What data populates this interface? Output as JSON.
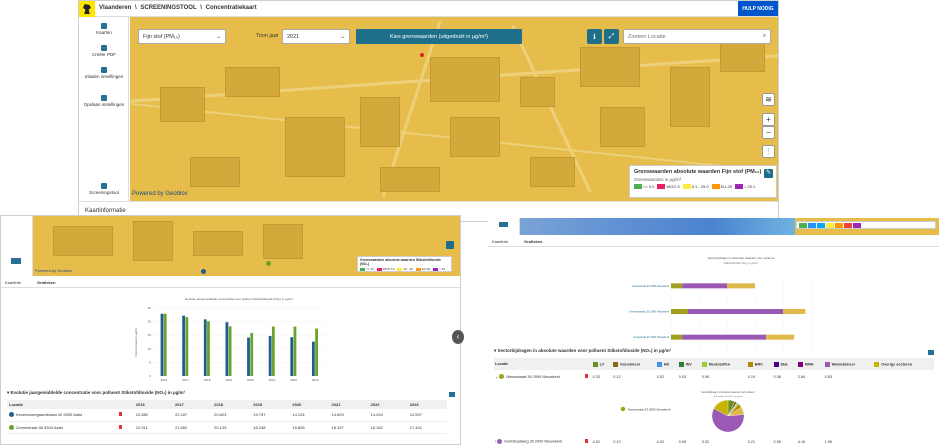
{
  "top": {
    "breadcrumb": [
      "Vlaanderen",
      "\\",
      "SCREENINGSTOOL",
      "\\",
      "Concentratiekaart"
    ],
    "help_label": "HULP NODIG",
    "sidebar": [
      {
        "label": "Kaarten",
        "icon": "layers-icon"
      },
      {
        "label": "Creëer PDF",
        "icon": "pdf-icon"
      },
      {
        "label": "Inladen instellingen",
        "icon": "upload-icon"
      },
      {
        "label": "Opslaan instellingen",
        "icon": "save-icon"
      },
      {
        "label": "Screeningstool",
        "icon": "link-icon"
      }
    ],
    "pollutant_select": "Fijn stof (PM₁₀)",
    "toon_jaar_label": "Toon jaar",
    "year_select": "2021",
    "toggle_button": "Kies grenswaarden (uitgedrukt in µg/m³)",
    "search_placeholder": "Zoeken Locatie",
    "legend_title": "Grenswaarden absolute waarden Fijn stof (PM₁₀)",
    "legend_subtitle": "Grenswaarden in µg/m³",
    "legend_items": [
      {
        "label": "<= 5.0",
        "color": "#4caf50"
      },
      {
        "label": "WGO 5",
        "color": "#e91e63"
      },
      {
        "label": "5.1 - 25.0",
        "color": "#ffeb3b"
      },
      {
        "label": "EU-25",
        "color": "#ff9800"
      },
      {
        "label": "> 25.1",
        "color": "#9c27b0"
      }
    ],
    "powered_by": "Powered by Geoblox",
    "tab": "Kaartinformatie"
  },
  "bottom_left": {
    "tabs": [
      "Kaartinfo",
      "Grafieken"
    ],
    "legend_title": "Grenswaarden absolute waarden Stikstofdioxide (NO₂)",
    "legend_items": [
      {
        "label": "<= 10",
        "color": "#4caf50"
      },
      {
        "label": "WGO 10",
        "color": "#e91e63"
      },
      {
        "label": "10 - 40",
        "color": "#ffeb3b"
      },
      {
        "label": "EU-40",
        "color": "#ff9800"
      },
      {
        "label": "> 40",
        "color": "#9c27b0"
      }
    ],
    "powered_by": "Powered by Geoblox",
    "table_title": "Evolutie jaargemiddelde concentratie voor polluent Stikstofdioxide (NO₂) in µg/m³",
    "table_headers": [
      "Locatie",
      "",
      "2016",
      "2017",
      "2018",
      "2019",
      "2020",
      "2021",
      "2022",
      "2023"
    ],
    "table_rows": [
      {
        "dot": "#1f5f8b",
        "name": "Kerseboomgaardstraat 42 9000 Aalst",
        "values": [
          "22.882",
          "22.187",
          "20.823",
          "19.797",
          "14.124",
          "14.693",
          "14.264",
          "12.597"
        ]
      },
      {
        "dot": "#6aa329",
        "name": "Zonnestraat 48 9300 Aalst",
        "values": [
          "22.911",
          "21.652",
          "20.139",
          "18.248",
          "15.806",
          "18.197",
          "18.182",
          "17.441"
        ]
      }
    ],
    "chart_data": {
      "type": "bar",
      "title": "Evolutie jaargemiddelde concentratie voor polluent Stikstofdioxide (NO₂) in µg/m³",
      "ylabel": "Concentratie in µg/m³",
      "categories": [
        "2016",
        "2017",
        "2018",
        "2019",
        "2020",
        "2021",
        "2022",
        "2023"
      ],
      "ylim": [
        0,
        25
      ],
      "yticks": [
        0,
        5,
        10,
        15,
        20,
        25
      ],
      "series": [
        {
          "name": "Kerseboomgaardstraat 42 9000 Aalst",
          "color": "#1f5f8b",
          "values": [
            22.882,
            22.187,
            20.823,
            19.797,
            14.124,
            14.693,
            14.264,
            12.597
          ]
        },
        {
          "name": "Zonnestraat 48 9300 Aalst",
          "color": "#6aa329",
          "values": [
            22.911,
            21.652,
            20.139,
            18.248,
            15.806,
            18.197,
            18.182,
            17.441
          ]
        }
      ]
    }
  },
  "bottom_right": {
    "tabs": [
      "Kaartinfo",
      "Grafieken"
    ],
    "chart_data": {
      "type": "bar",
      "stacked": true,
      "orientation": "horizontal",
      "title": "Sectorbijdragen in absolute waarden voor polluent",
      "subtitle": "Stikstofdioxide (NO₂) in µg/m³",
      "xlabel": "Bijdrage in µg/m³",
      "categories": [
        "Nieuwstraat 35 2990 Nieuwkerk",
        "Kerkstraatweg 35 2990 Nieuwkerk",
        "Hoogstraat 46 2990 Nieuwkerk"
      ],
      "xlim": [
        0,
        25
      ],
      "xticks": [
        0,
        5,
        10,
        15,
        20,
        25
      ],
      "series": [
        {
          "name": "Verkeer",
          "color": "#a0a01e",
          "values": [
            2,
            3,
            2
          ]
        },
        {
          "name": "Industrie",
          "color": "#9b59b6",
          "values": [
            8,
            17,
            15
          ]
        },
        {
          "name": "Overige",
          "color": "#e0b94b",
          "values": [
            5,
            4,
            5
          ]
        }
      ]
    },
    "table_title": "Sectorbijdragen in absolute waarden voor polluent Stikstofdioxide (NO₂) in µg/m³",
    "table_headers": [
      {
        "label": "Locatie",
        "color": ""
      },
      {
        "label": "",
        "color": ""
      },
      {
        "label": "LV",
        "color": "#6b8e23"
      },
      {
        "label": "Kunstmest",
        "color": "#8b6914"
      },
      {
        "label": "HD",
        "color": "#4a90e2"
      },
      {
        "label": "WV",
        "color": "#2e7d32"
      },
      {
        "label": "Meststoffen",
        "color": "#9acd32"
      },
      {
        "label": "BRV",
        "color": "#b38b00"
      },
      {
        "label": "Stal",
        "color": "#4b0082"
      },
      {
        "label": "NMH",
        "color": "#800080"
      },
      {
        "label": "Weidebeheer",
        "color": "#9b59b6"
      },
      {
        "label": "Overige sectoren",
        "color": "#c8b400"
      }
    ],
    "table_rows": [
      {
        "dot": "#a0a01e",
        "name": "Nieuwstraat 35 2990 Nieuwkerk",
        "values": [
          "0.33",
          "0.12",
          "0.02",
          "0.03",
          "0.06",
          "0.19",
          "0.38",
          "2.84",
          "0.83"
        ]
      },
      {
        "dot": "#9b59b6",
        "name": "Kerkstraatweg 35 2990 Nieuwkerk",
        "values": [
          "0.52",
          "0.10",
          "0.02",
          "0.05",
          "0.02",
          "0.21",
          "0.56",
          "4.19",
          "1.96"
        ]
      }
    ],
    "pie_title": "Sectorbijdragen in absolute waarden voor polluent",
    "pie_subtitle": "Stikstofdioxide (NO₂) in µg/m³",
    "pie_location": "Nieuwstraat 35 2990 Nieuwkerk",
    "pie_data": {
      "type": "pie",
      "slices": [
        {
          "name": "LV",
          "value": 0.33,
          "color": "#6b8e23"
        },
        {
          "name": "Kunstmest",
          "value": 0.12,
          "color": "#8b6914"
        },
        {
          "name": "HD",
          "value": 0.02,
          "color": "#4a90e2"
        },
        {
          "name": "WV",
          "value": 0.03,
          "color": "#2e7d32"
        },
        {
          "name": "Meststoffen",
          "value": 0.06,
          "color": "#9acd32"
        },
        {
          "name": "BRV",
          "value": 0.19,
          "color": "#b38b00"
        },
        {
          "name": "NMH",
          "value": 0.38,
          "color": "#e0b94b"
        },
        {
          "name": "Weidebeheer",
          "value": 2.84,
          "color": "#9b59b6"
        },
        {
          "name": "Overige sectoren",
          "value": 0.83,
          "color": "#c8b400"
        }
      ]
    }
  }
}
